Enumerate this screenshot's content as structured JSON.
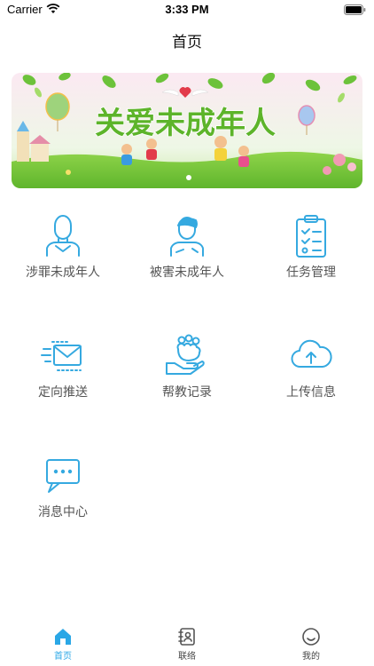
{
  "status_bar": {
    "carrier": "Carrier",
    "time": "3:33 PM"
  },
  "nav": {
    "title": "首页"
  },
  "banner": {
    "text": "关爱未成年人"
  },
  "grid": [
    {
      "label": "涉罪未成年人",
      "icon": "person-outline-icon"
    },
    {
      "label": "被害未成年人",
      "icon": "person-hurt-icon"
    },
    {
      "label": "任务管理",
      "icon": "clipboard-checklist-icon"
    },
    {
      "label": "定向推送",
      "icon": "envelope-send-icon"
    },
    {
      "label": "帮教记录",
      "icon": "helping-hand-icon"
    },
    {
      "label": "上传信息",
      "icon": "cloud-upload-icon"
    },
    {
      "label": "消息中心",
      "icon": "chat-bubble-icon"
    }
  ],
  "tabbar": [
    {
      "label": "首页",
      "icon": "home-icon",
      "active": true
    },
    {
      "label": "联络",
      "icon": "contacts-icon",
      "active": false
    },
    {
      "label": "我的",
      "icon": "smiley-icon",
      "active": false
    }
  ],
  "colors": {
    "accent": "#2aa7e6",
    "icon_blue": "#35a9e0"
  }
}
